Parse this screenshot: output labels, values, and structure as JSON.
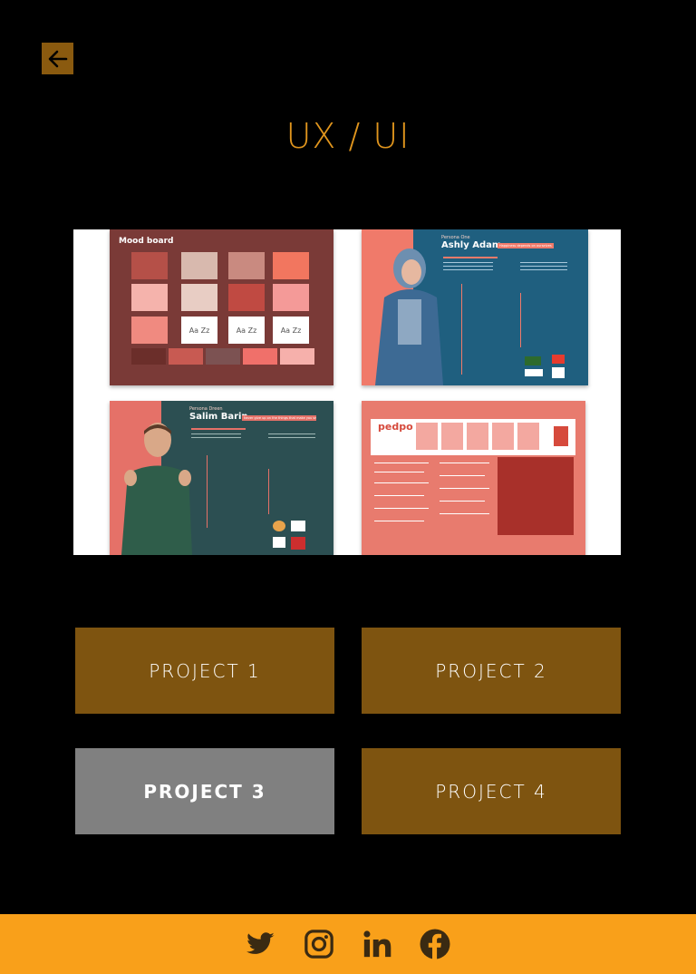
{
  "header": {
    "back_label": "",
    "title": "UX / UI"
  },
  "showcase": {
    "moodboard": {
      "title": "Mood board",
      "type_samples": [
        "Aa Zz",
        "Aa Zz",
        "Aa Zz"
      ]
    },
    "persona1": {
      "kicker": "Persona One",
      "name": "Ashly Adam",
      "tag": "Happiness depends on ourselves"
    },
    "persona2": {
      "kicker": "Persona Dreen",
      "name": "Salim Barin",
      "tag": "Never give up on the things that make you smile"
    },
    "brief": {
      "logo": "pedpo"
    }
  },
  "projects": [
    {
      "label": "PROJECT 1",
      "active": false
    },
    {
      "label": "PROJECT 2",
      "active": false
    },
    {
      "label": "PROJECT 3",
      "active": true
    },
    {
      "label": "PROJECT 4",
      "active": false
    }
  ],
  "footer": {
    "icons": [
      "twitter-icon",
      "instagram-icon",
      "linkedin-icon",
      "facebook-icon"
    ]
  },
  "colors": {
    "accent": "#e0951d",
    "button": "#7e5410",
    "active_button": "#808080",
    "footer": "#f9a01a"
  }
}
